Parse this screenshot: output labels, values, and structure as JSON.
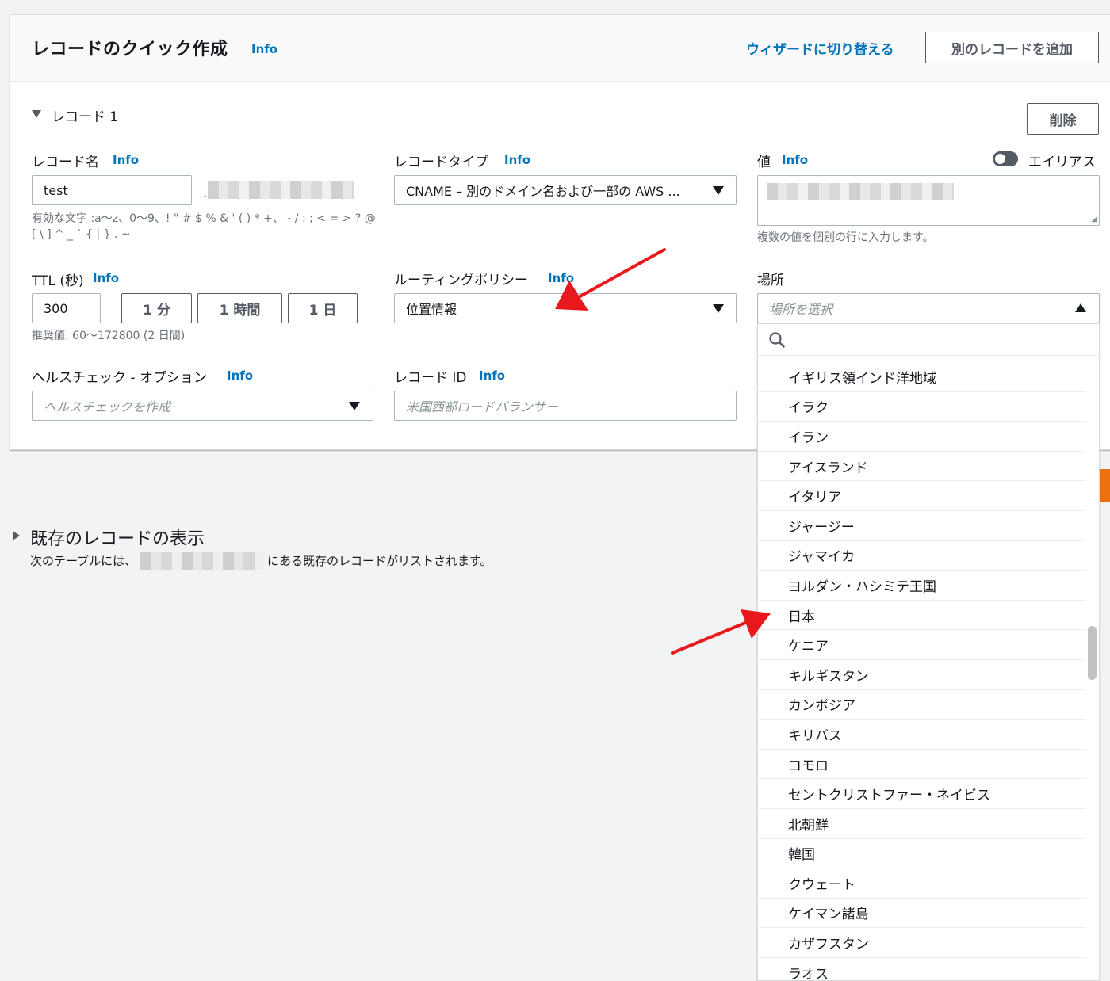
{
  "header": {
    "title": "レコードのクイック作成",
    "info": "Info",
    "switch_wizard": "ウィザードに切り替える",
    "add_record": "別のレコードを追加"
  },
  "record": {
    "section_label": "レコード 1",
    "delete": "削除",
    "name": {
      "label": "レコード名",
      "info": "Info",
      "value": "test",
      "dot": ".",
      "hint_line1": "有効な文字 :a〜z、0〜9、! \" # $ % & ' ( ) * +、 - / : ; < = > ? @",
      "hint_line2": "[ \\ ] ^ _ ` { | } . ~"
    },
    "type": {
      "label": "レコードタイプ",
      "info": "Info",
      "value": "CNAME – 別のドメイン名および一部の AWS ..."
    },
    "value": {
      "label": "値",
      "info": "Info",
      "alias_label": "エイリアス",
      "hint": "複数の値を個別の行に入力します。"
    },
    "ttl": {
      "label": "TTL (秒)",
      "info": "Info",
      "value": "300",
      "btn_1m": "1 分",
      "btn_1h": "1 時間",
      "btn_1d": "1 日",
      "hint": "推奨値: 60〜172800 (2 日間)"
    },
    "routing": {
      "label": "ルーティングポリシー",
      "info": "Info",
      "value": "位置情報"
    },
    "location": {
      "label": "場所",
      "placeholder": "場所を選択"
    },
    "health": {
      "label": "ヘルスチェック - オプション",
      "info": "Info",
      "placeholder": "ヘルスチェックを作成"
    },
    "record_id": {
      "label": "レコード ID",
      "info": "Info",
      "placeholder": "米国西部ロードバランサー"
    }
  },
  "existing": {
    "title": "既存のレコードの表示",
    "desc_before": "次のテーブルには、",
    "desc_after": "にある既存のレコードがリストされます。"
  },
  "dropdown": {
    "items": [
      "イギリス領インド洋地域",
      "イラク",
      "イラン",
      "アイスランド",
      "イタリア",
      "ジャージー",
      "ジャマイカ",
      "ヨルダン・ハシミテ王国",
      "日本",
      "ケニア",
      "キルギスタン",
      "カンボジア",
      "キリバス",
      "コモロ",
      "セントクリストファー・ネイビス",
      "北朝鮮",
      "韓国",
      "クウェート",
      "ケイマン諸島",
      "カザフスタン",
      "ラオス"
    ]
  },
  "colors": {
    "link": "#0073bb",
    "annotation_arrow": "#e8191c",
    "accent": "#ec7211"
  }
}
